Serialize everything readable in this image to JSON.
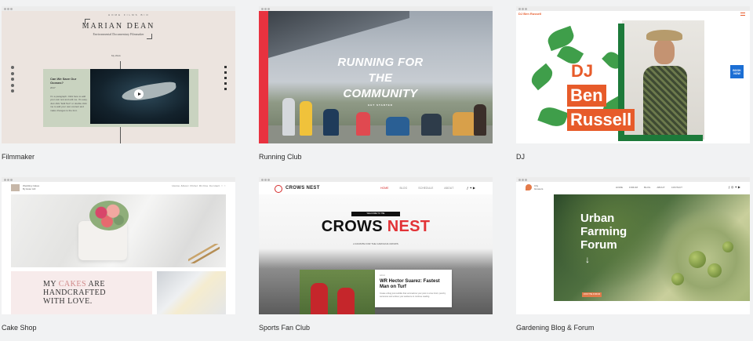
{
  "templates": [
    {
      "caption": "Filmmaker",
      "preview": {
        "top_nav": [
          "HOME",
          "FILMS",
          "BIO"
        ],
        "name": "MARIAN DEAN",
        "subtitle": "Environmental Documentary Filmmaker",
        "section_label": "My Work",
        "story_heading": "Can We Save Our Oceans?",
        "story_year": "2017",
        "story_text": "I'm a paragraph. Click here to add your own text and edit me. It's easy. Just click \"Edit Text\" or double click me to add your own content and make changes to the font."
      }
    },
    {
      "caption": "Running Club",
      "preview": {
        "headline_line1": "RUNNING FOR",
        "headline_line2": "THE COMMUNITY",
        "button": "GET STARTED"
      }
    },
    {
      "caption": "DJ",
      "preview": {
        "brand": "DJ Ben Russell",
        "word1": "DJ",
        "word2": "Ben",
        "word3": "Russell",
        "book_label": "BOOK NOW"
      }
    },
    {
      "caption": "Cake Shop",
      "preview": {
        "shop_name": "Wedding Cakes",
        "shop_sub": "By Ester Hill",
        "nav": [
          "Home",
          "About",
          "Order Online",
          "Contact"
        ],
        "headline_line1": "MY",
        "headline_accent": "CAKES",
        "headline_line1_rest": "ARE",
        "headline_line2": "HANDCRAFTED",
        "headline_line3": "WITH LOVE."
      }
    },
    {
      "caption": "Sports Fan Club",
      "preview": {
        "brand": "CROWS NEST",
        "nav": [
          "HOME",
          "BLOG",
          "SCHEDULE",
          "ABOUT"
        ],
        "welcome": "WELCOME TO THE",
        "headline_a": "CROWS",
        "headline_b": "NEST",
        "tagline": "A FANSITE FOR THE CAROLINA CROWS",
        "article_meta": "Admin",
        "article_title": "WR Hector Suarez: Fastest Man on Turf",
        "article_text": "Create a blog post subtitle that summarizes your post in a few short, punchy sentences and entices your audience to continue reading."
      }
    },
    {
      "caption": "Gardening Blog & Forum",
      "preview": {
        "brand_line1": "City",
        "brand_line2": "Growers",
        "nav": [
          "HOME",
          "FORUM",
          "BLOG",
          "ABOUT",
          "CONTACT"
        ],
        "headline_line1": "Urban",
        "headline_line2": "Farming",
        "headline_line3": "Forum",
        "button": "JOIN THE FORUM"
      }
    }
  ],
  "colors": {
    "background": "#f1f2f3",
    "running_red": "#e8323f",
    "dj_orange": "#e75b2a",
    "dj_green": "#1d7a3a",
    "crows_red": "#e23236",
    "garden_orange": "#e07a4a"
  }
}
